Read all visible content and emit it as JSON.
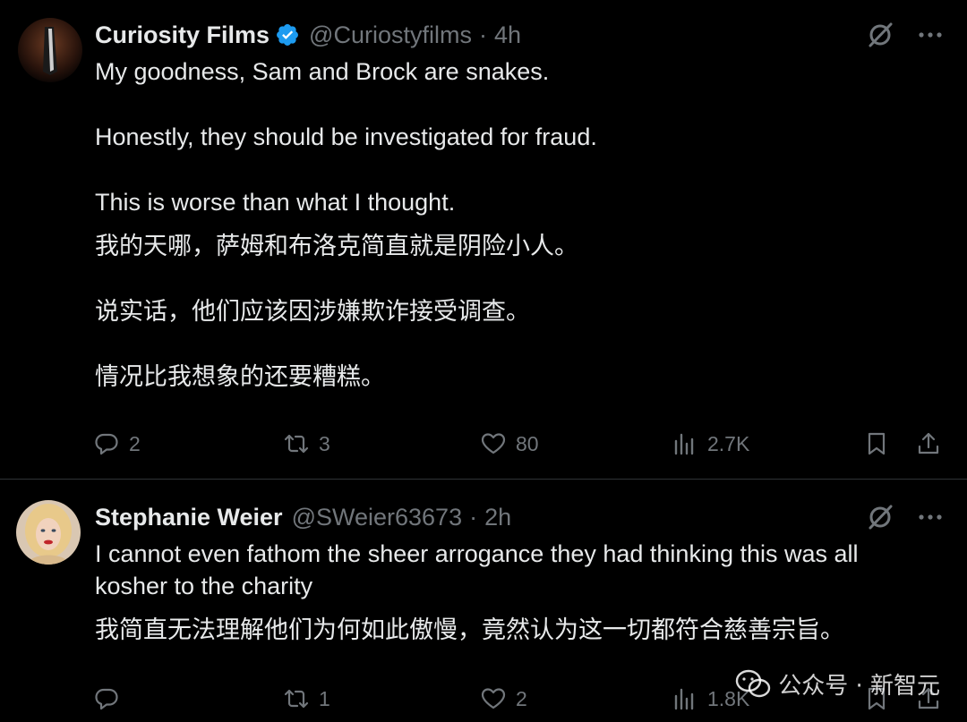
{
  "tweets": [
    {
      "display_name": "Curiosity Films",
      "handle": "@Curiostyfilms",
      "separator": "·",
      "time": "4h",
      "verified": true,
      "paragraphs_en": [
        "My goodness, Sam and Brock are snakes.",
        "Honestly, they should be investigated for fraud.",
        "This is worse than what I thought."
      ],
      "paragraphs_zh": [
        "我的天哪，萨姆和布洛克简直就是阴险小人。",
        "说实话，他们应该因涉嫌欺诈接受调查。",
        "情况比我想象的还要糟糕。"
      ],
      "stats": {
        "replies": "2",
        "reposts": "3",
        "likes": "80",
        "views": "2.7K"
      },
      "icons": [
        "grok-icon",
        "more-icon",
        "reply-icon",
        "repost-icon",
        "like-icon",
        "views-icon",
        "bookmark-icon",
        "share-icon"
      ]
    },
    {
      "display_name": "Stephanie Weier",
      "handle": "@SWeier63673",
      "separator": "·",
      "time": "2h",
      "verified": false,
      "paragraphs_en": [
        "I cannot even fathom the sheer arrogance they had thinking this was all kosher to the charity"
      ],
      "paragraphs_zh": [
        "我简直无法理解他们为何如此傲慢，竟然认为这一切都符合慈善宗旨。"
      ],
      "stats": {
        "replies": "",
        "reposts": "1",
        "likes": "2",
        "views": "1.8K"
      }
    }
  ],
  "watermark": {
    "text": "公众号 · 新智元"
  },
  "colors": {
    "background": "#000000",
    "text": "#e7e9ea",
    "muted": "#71767b",
    "verified": "#1d9bf0",
    "divider": "#2f3336"
  }
}
